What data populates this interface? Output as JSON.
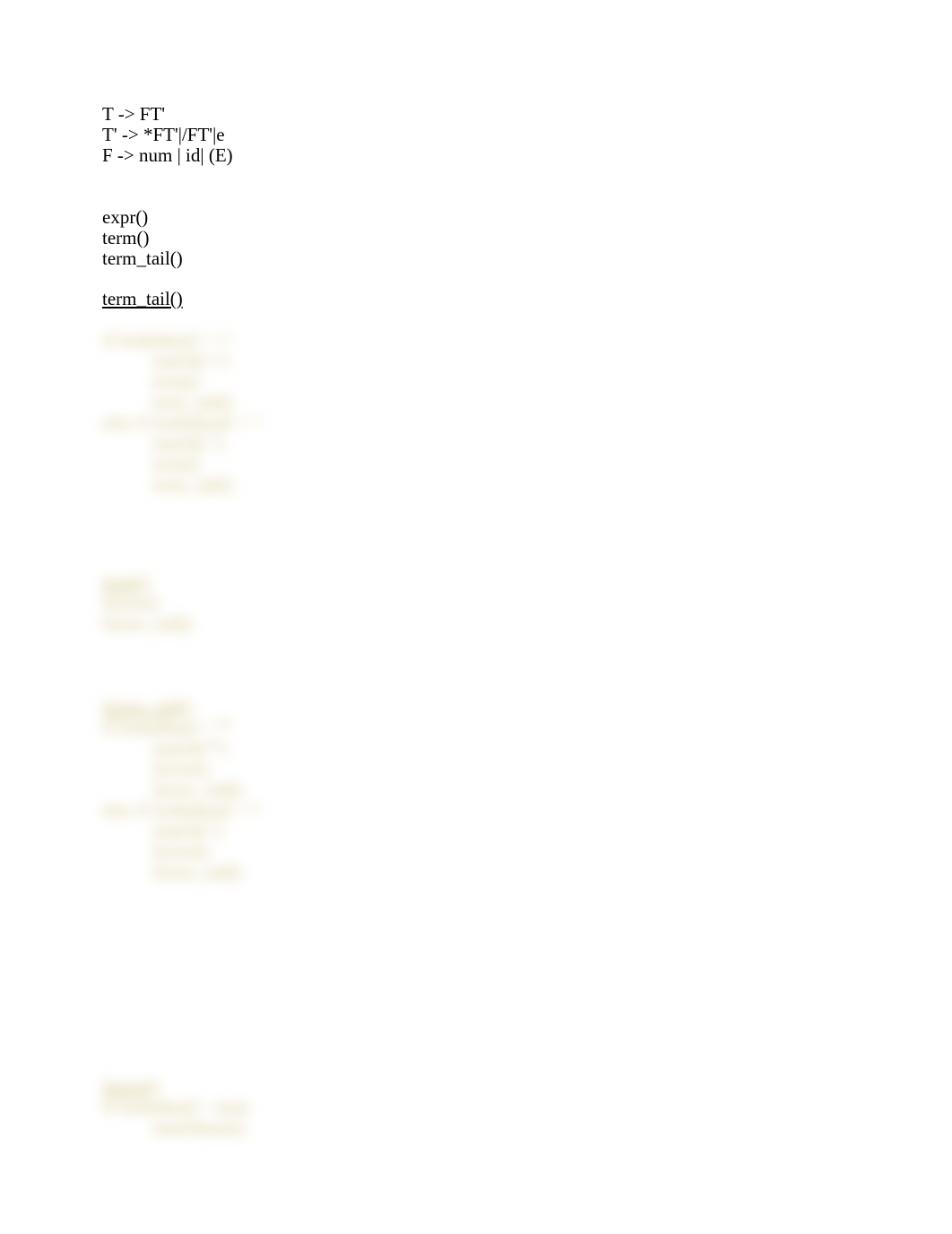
{
  "grammar": {
    "rule1": "T -> FT'",
    "rule2": "T' -> *FT'|/FT'|e",
    "rule3": "F -> num | id| (E)"
  },
  "calls": {
    "expr": "expr()",
    "term": "term()",
    "term_tail": "term_tail()"
  },
  "heading_term_tail": "term_tail()",
  "obscured_note": "remaining pseudocode is blurred in the source image and not legible"
}
